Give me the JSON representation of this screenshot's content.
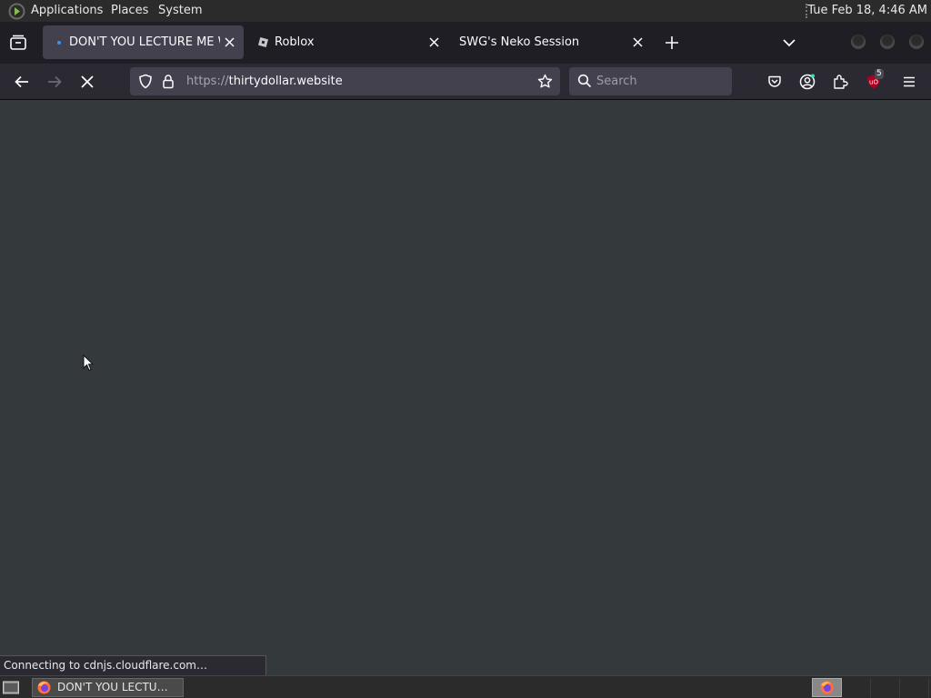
{
  "system_panel": {
    "menus": [
      "Applications",
      "Places",
      "System"
    ],
    "clock": "Tue Feb 18,  4:46 AM"
  },
  "browser": {
    "tabs": [
      {
        "title": "DON'T YOU LECTURE ME W",
        "active": true,
        "loading": true
      },
      {
        "title": "Roblox",
        "active": false,
        "favicon": "roblox-icon"
      },
      {
        "title": "SWG's Neko Session",
        "active": false
      }
    ],
    "url": {
      "scheme": "https://",
      "host": "thirtydollar.website"
    },
    "search": {
      "placeholder": "Search"
    },
    "extension_badge": "5",
    "status": "Connecting to cdnjs.cloudflare.com…",
    "colors": {
      "toolbar": "#2b2a33",
      "tabstrip": "#1f1e25",
      "active_tab": "#42414d",
      "content_bg": "#343a3b",
      "loading_dot": "#3a93f0",
      "ublock_red": "#b00020"
    }
  },
  "taskbar": {
    "window_label": "DON'T YOU LECTU…",
    "workspace_count": 4
  }
}
